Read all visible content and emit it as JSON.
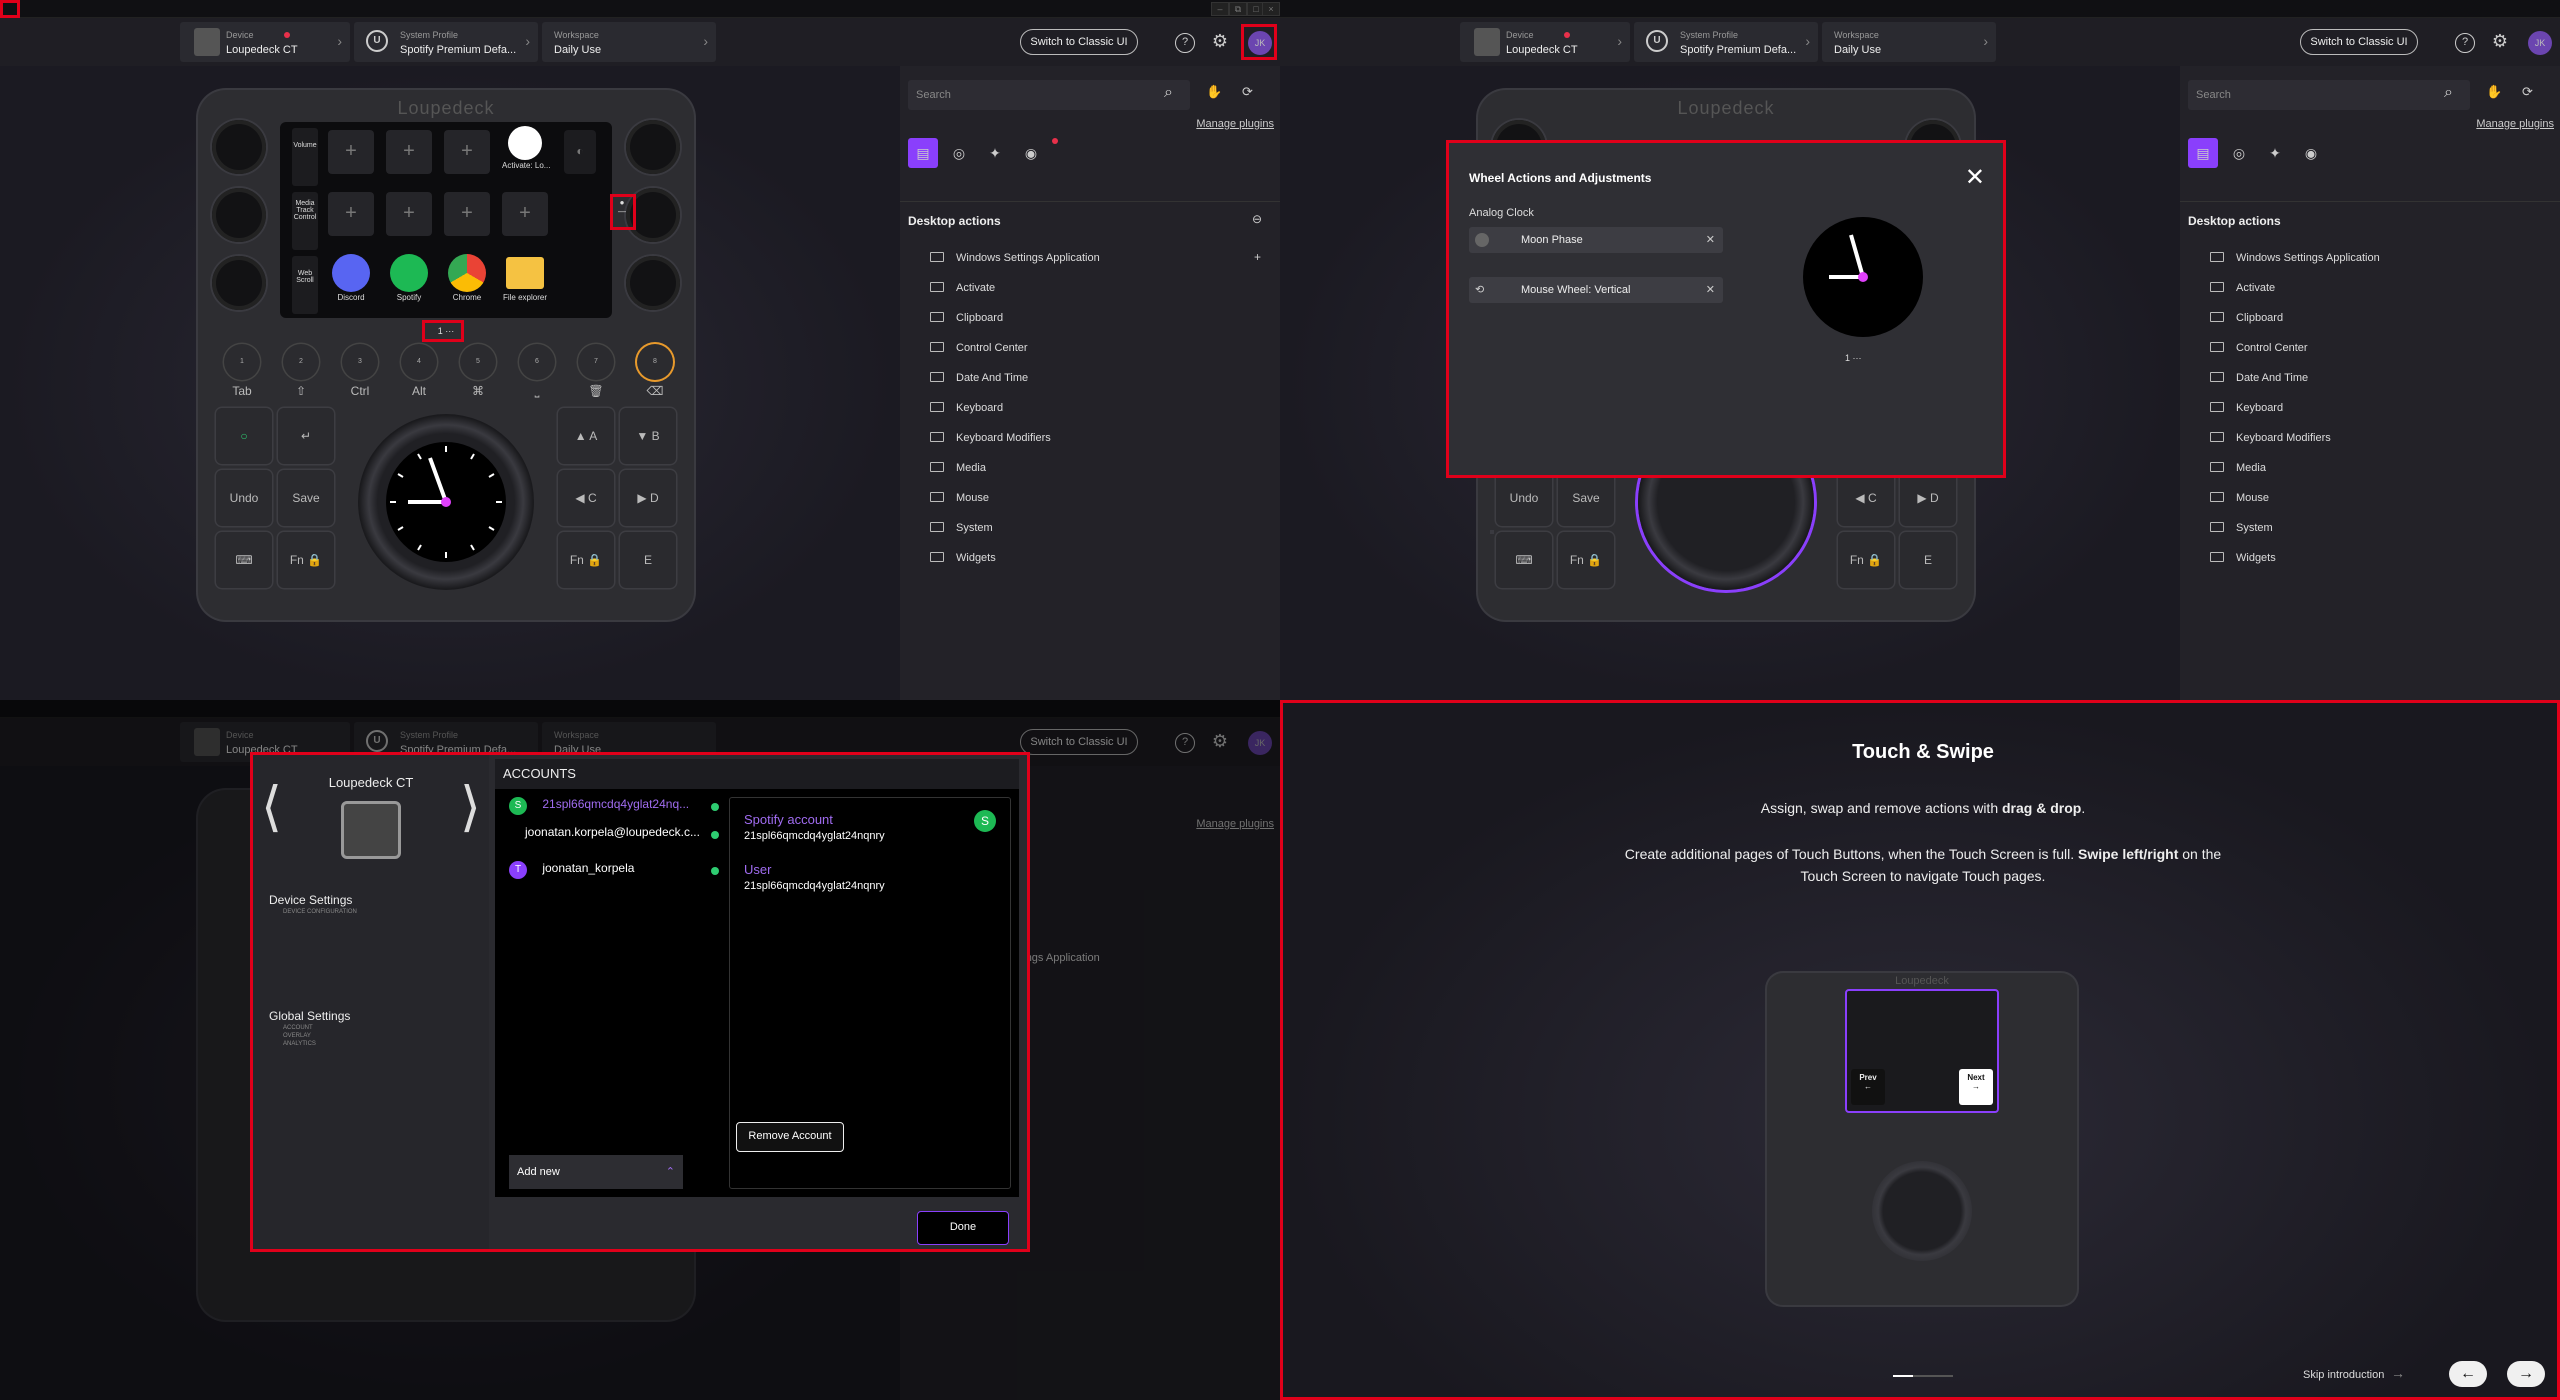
{
  "header": {
    "device_label": "Device",
    "device_name": "Loupedeck CT",
    "profile_label": "System Profile",
    "profile_name": "Spotify Premium Defa...",
    "workspace_label": "Workspace",
    "workspace_name": "Daily Use",
    "classic_ui": "Switch to Classic UI",
    "avatar": "JK",
    "help": "?"
  },
  "device": {
    "logo": "Loupedeck",
    "side_volume": "Volume",
    "side_media": "Media Track Control",
    "side_web": "Web Scroll",
    "activate": "Activate: Lo...",
    "apps": [
      "Discord",
      "Spotify",
      "Chrome",
      "File explorer"
    ],
    "round_buttons": [
      "1",
      "2",
      "3",
      "4",
      "5",
      "6",
      "7",
      "8"
    ],
    "round_labels": [
      "Tab",
      "⇧",
      "Ctrl",
      "Alt",
      "⌘",
      "⎵",
      "🗑",
      "⌫"
    ],
    "undo": "Undo",
    "save": "Save",
    "fn": "Fn",
    "letters": [
      "A",
      "B",
      "C",
      "D",
      "E"
    ],
    "page_indicator": "1 ···"
  },
  "panel": {
    "search_placeholder": "Search",
    "manage_plugins": "Manage plugins",
    "section": "Desktop actions",
    "folders": [
      "Windows Settings Application",
      "Activate",
      "Clipboard",
      "Control Center",
      "Date And Time",
      "Keyboard",
      "Keyboard Modifiers",
      "Media",
      "Mouse",
      "System",
      "Widgets"
    ]
  },
  "wheel_modal": {
    "title": "Wheel Actions and Adjustments",
    "subtitle": "Analog Clock",
    "action1": "Moon Phase",
    "action2": "Mouse Wheel: Vertical",
    "page": "1 ···"
  },
  "settings": {
    "device_name": "Loupedeck CT",
    "device_settings": "Device Settings",
    "device_settings_sub": "DEVICE CONFIGURATION",
    "global_settings": "Global Settings",
    "global_sub": [
      "ACCOUNT",
      "OVERLAY",
      "ANALYTICS"
    ],
    "accounts_title": "ACCOUNTS",
    "accounts": [
      {
        "icon": "S",
        "name": "21spl66qmcdq4yglat24nq...",
        "color": "#a06cf0"
      },
      {
        "icon": "",
        "name": "joonatan.korpela@loupedeck.c...",
        "color": "#ffffff"
      },
      {
        "icon": "T",
        "name": "joonatan_korpela",
        "color": "#ffffff"
      }
    ],
    "add_new": "Add new",
    "detail_title": "Spotify account",
    "detail_id": "21spl66qmcdq4yglat24nqnry",
    "user_label": "User",
    "user_id": "21spl66qmcdq4yglat24nqnry",
    "remove": "Remove Account",
    "done": "Done"
  },
  "intro": {
    "title": "Touch & Swipe",
    "line1_a": "Assign, swap and remove actions with ",
    "line1_b": "drag & drop",
    "line1_c": ".",
    "line2_a": "Create additional pages of Touch Buttons, when the Touch Screen is full. ",
    "line2_b": "Swipe left/right",
    "line2_c": " on the",
    "line3": "Touch Screen to navigate Touch pages.",
    "prev": "Prev",
    "next": "Next",
    "skip": "Skip introduction",
    "logo": "Loupedeck"
  },
  "colors": {
    "accent": "#8a3ffc",
    "danger": "#e0001a",
    "spotify": "#1db954"
  }
}
